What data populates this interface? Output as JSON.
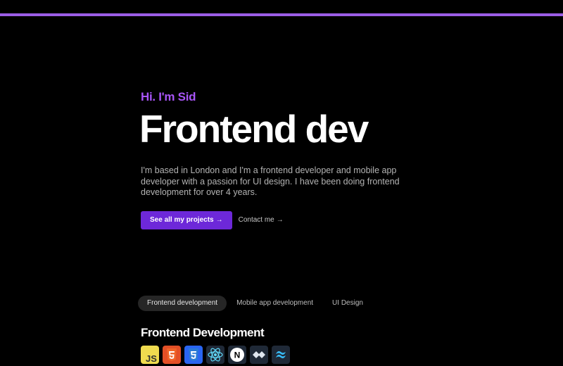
{
  "hero": {
    "greeting": "Hi. I'm Sid",
    "headline": "Frontend dev",
    "intro": "I'm based in London and I'm a frontend developer and mobile app developer with a passion for UI design. I have been doing frontend development for over 4 years.",
    "primary_cta": "See all my projects",
    "secondary_cta": "Contact me",
    "arrow": "→"
  },
  "tabs": [
    {
      "label": "Frontend development",
      "active": true
    },
    {
      "label": "Mobile app development",
      "active": false
    },
    {
      "label": "UI Design",
      "active": false
    }
  ],
  "section": {
    "title": "Frontend Development",
    "tech_icons": [
      "javascript-icon",
      "html5-icon",
      "css3-icon",
      "react-icon",
      "nextjs-icon",
      "vue-icon",
      "tailwind-icon"
    ]
  },
  "colors": {
    "accent": "#a855f7",
    "button": "#6d28d9",
    "top_bar": "#9b5de5",
    "background": "#000000"
  }
}
